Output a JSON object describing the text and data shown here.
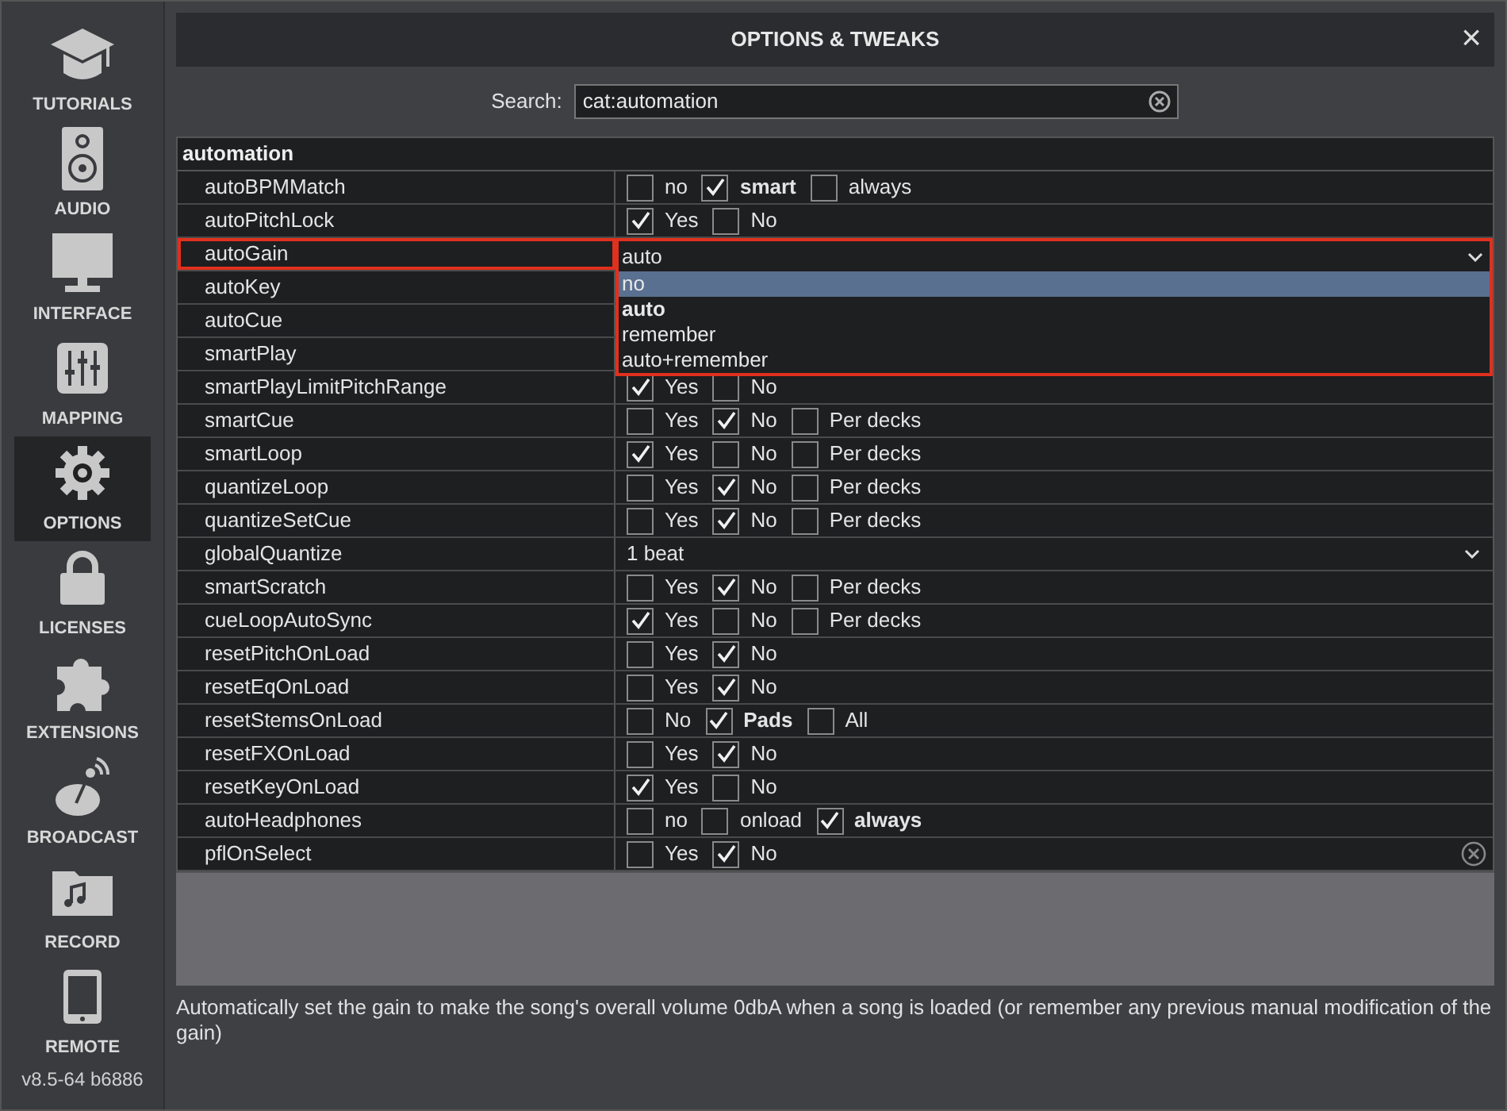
{
  "sidebar": {
    "items": [
      {
        "label": "TUTORIALS",
        "selected": false
      },
      {
        "label": "AUDIO",
        "selected": false
      },
      {
        "label": "INTERFACE",
        "selected": false
      },
      {
        "label": "MAPPING",
        "selected": false
      },
      {
        "label": "OPTIONS",
        "selected": true
      },
      {
        "label": "LICENSES",
        "selected": false
      },
      {
        "label": "EXTENSIONS",
        "selected": false
      },
      {
        "label": "BROADCAST",
        "selected": false
      },
      {
        "label": "RECORD",
        "selected": false
      },
      {
        "label": "REMOTE",
        "selected": false
      }
    ],
    "version": "v8.5-64 b6886"
  },
  "window": {
    "title": "OPTIONS & TWEAKS",
    "close": "×"
  },
  "search": {
    "label": "Search:",
    "value": "cat:automation"
  },
  "table": {
    "group": "automation",
    "rows": [
      {
        "name": "autoBPMMatch",
        "kind": "checks",
        "options": [
          {
            "label": "no",
            "checked": false,
            "default": false
          },
          {
            "label": "smart",
            "checked": true,
            "default": true
          },
          {
            "label": "always",
            "checked": false,
            "default": false
          }
        ]
      },
      {
        "name": "autoPitchLock",
        "kind": "checks",
        "options": [
          {
            "label": "Yes",
            "checked": true,
            "default": false
          },
          {
            "label": "No",
            "checked": false,
            "default": false
          }
        ]
      },
      {
        "name": "autoGain",
        "kind": "select",
        "highlighted": true,
        "value": "auto",
        "expanded": true,
        "choices": [
          {
            "label": "no",
            "hovered": true,
            "selected": false
          },
          {
            "label": "auto",
            "hovered": false,
            "selected": true
          },
          {
            "label": "remember",
            "hovered": false,
            "selected": false
          },
          {
            "label": "auto+remember",
            "hovered": false,
            "selected": false
          }
        ]
      },
      {
        "name": "autoKey",
        "kind": "covered"
      },
      {
        "name": "autoCue",
        "kind": "covered"
      },
      {
        "name": "smartPlay",
        "kind": "covered"
      },
      {
        "name": "smartPlayLimitPitchRange",
        "kind": "checks",
        "options": [
          {
            "label": "Yes",
            "checked": true,
            "default": false
          },
          {
            "label": "No",
            "checked": false,
            "default": false
          }
        ]
      },
      {
        "name": "smartCue",
        "kind": "checks",
        "options": [
          {
            "label": "Yes",
            "checked": false,
            "default": false
          },
          {
            "label": "No",
            "checked": true,
            "default": false
          },
          {
            "label": "Per decks",
            "checked": false,
            "default": false
          }
        ]
      },
      {
        "name": "smartLoop",
        "kind": "checks",
        "options": [
          {
            "label": "Yes",
            "checked": true,
            "default": false
          },
          {
            "label": "No",
            "checked": false,
            "default": false
          },
          {
            "label": "Per decks",
            "checked": false,
            "default": false
          }
        ]
      },
      {
        "name": "quantizeLoop",
        "kind": "checks",
        "options": [
          {
            "label": "Yes",
            "checked": false,
            "default": false
          },
          {
            "label": "No",
            "checked": true,
            "default": false
          },
          {
            "label": "Per decks",
            "checked": false,
            "default": false
          }
        ]
      },
      {
        "name": "quantizeSetCue",
        "kind": "checks",
        "options": [
          {
            "label": "Yes",
            "checked": false,
            "default": false
          },
          {
            "label": "No",
            "checked": true,
            "default": false
          },
          {
            "label": "Per decks",
            "checked": false,
            "default": false
          }
        ]
      },
      {
        "name": "globalQuantize",
        "kind": "select",
        "value": "1 beat",
        "expanded": false
      },
      {
        "name": "smartScratch",
        "kind": "checks",
        "options": [
          {
            "label": "Yes",
            "checked": false,
            "default": false
          },
          {
            "label": "No",
            "checked": true,
            "default": false
          },
          {
            "label": "Per decks",
            "checked": false,
            "default": false
          }
        ]
      },
      {
        "name": "cueLoopAutoSync",
        "kind": "checks",
        "options": [
          {
            "label": "Yes",
            "checked": true,
            "default": false
          },
          {
            "label": "No",
            "checked": false,
            "default": false
          },
          {
            "label": "Per decks",
            "checked": false,
            "default": false
          }
        ]
      },
      {
        "name": "resetPitchOnLoad",
        "kind": "checks",
        "options": [
          {
            "label": "Yes",
            "checked": false,
            "default": false
          },
          {
            "label": "No",
            "checked": true,
            "default": false
          }
        ]
      },
      {
        "name": "resetEqOnLoad",
        "kind": "checks",
        "options": [
          {
            "label": "Yes",
            "checked": false,
            "default": false
          },
          {
            "label": "No",
            "checked": true,
            "default": false
          }
        ]
      },
      {
        "name": "resetStemsOnLoad",
        "kind": "checks",
        "options": [
          {
            "label": "No",
            "checked": false,
            "default": false
          },
          {
            "label": "Pads",
            "checked": true,
            "default": true
          },
          {
            "label": "All",
            "checked": false,
            "default": false
          }
        ]
      },
      {
        "name": "resetFXOnLoad",
        "kind": "checks",
        "options": [
          {
            "label": "Yes",
            "checked": false,
            "default": false
          },
          {
            "label": "No",
            "checked": true,
            "default": false
          }
        ]
      },
      {
        "name": "resetKeyOnLoad",
        "kind": "checks",
        "options": [
          {
            "label": "Yes",
            "checked": true,
            "default": false
          },
          {
            "label": "No",
            "checked": false,
            "default": false
          }
        ]
      },
      {
        "name": "autoHeadphones",
        "kind": "checks",
        "options": [
          {
            "label": "no",
            "checked": false,
            "default": false
          },
          {
            "label": "onload",
            "checked": false,
            "default": false
          },
          {
            "label": "always",
            "checked": true,
            "default": true
          }
        ]
      },
      {
        "name": "pflOnSelect",
        "kind": "checks",
        "reset_button": true,
        "options": [
          {
            "label": "Yes",
            "checked": false,
            "default": false
          },
          {
            "label": "No",
            "checked": true,
            "default": false
          }
        ]
      }
    ]
  },
  "description": "Automatically set the gain to make the song's overall volume 0dbA when a song is loaded (or remember any previous manual modification of the gain)"
}
